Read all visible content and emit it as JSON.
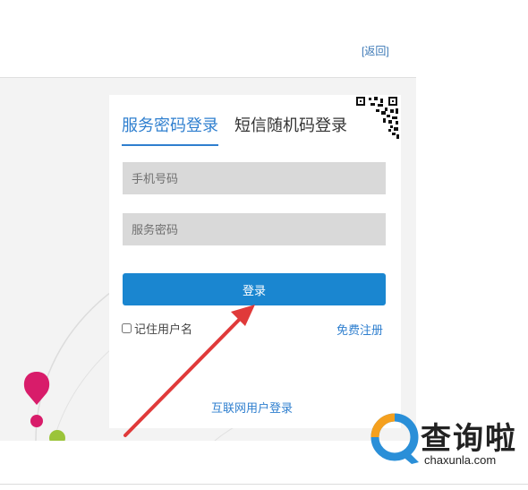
{
  "header": {
    "back_label": "[返回]"
  },
  "login": {
    "tabs": [
      {
        "label": "服务密码登录",
        "active": true
      },
      {
        "label": "短信随机码登录",
        "active": false
      }
    ],
    "phone_placeholder": "手机号码",
    "password_placeholder": "服务密码",
    "login_button": "登录",
    "remember_label": "记住用户名",
    "register_link": "免费注册",
    "internet_login_link": "互联网用户登录",
    "qr_icon": "qr-code-icon"
  },
  "watermark": {
    "name_cn": "查询啦",
    "name_en": "chaxunla.com",
    "colors": {
      "orange": "#f5a01e",
      "blue": "#2a8fd8"
    }
  },
  "colors": {
    "accent": "#2f7fcf",
    "button": "#1a86d0",
    "field": "#d9d9d9",
    "arrow": "#e03a3a",
    "pin": "#d81c6a",
    "dot_green": "#9bc43a"
  }
}
